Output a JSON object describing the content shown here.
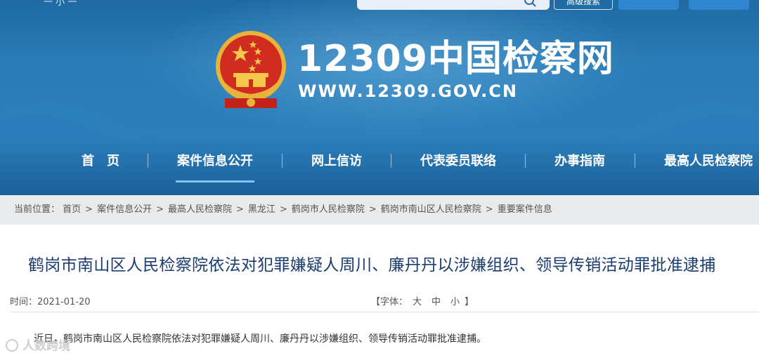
{
  "header": {
    "top_left_text": "一 小 一",
    "advanced_search_label": "高级搜索",
    "site_title": "12309中国检察网",
    "site_url": "WWW.12309.GOV.CN"
  },
  "nav": {
    "items": [
      {
        "label": "首　页"
      },
      {
        "label": "案件信息公开"
      },
      {
        "label": "网上信访"
      },
      {
        "label": "代表委员联络"
      },
      {
        "label": "办事指南"
      },
      {
        "label": "最高人民检察院"
      }
    ],
    "active_index": 1
  },
  "breadcrumb": {
    "prefix": "当前位置：",
    "items": [
      "首页",
      "案件信息公开",
      "最高人民检察院",
      "黑龙江",
      "鹤岗市人民检察院",
      "鹤岗市南山区人民检察院",
      "重要案件信息"
    ],
    "separator": ">"
  },
  "article": {
    "title": "鹤岗市南山区人民检察院依法对犯罪嫌疑人周川、廉丹丹以涉嫌组织、领导传销活动罪批准逮捕",
    "time_label": "时间：",
    "time_value": "2021-01-20",
    "font_size_prefix": "【字体：",
    "font_size_options": [
      "大",
      "中",
      "小"
    ],
    "font_size_suffix": "】",
    "body": "近日，鹤岗市南山区人民检察院依法对犯罪嫌疑人周川、廉丹丹以涉嫌组织、领导传销活动罪批准逮捕。"
  },
  "watermark": "人数跨境",
  "colors": {
    "banner": "#2a7bb6",
    "nav_active_underline": "#7ec6f2",
    "title_text": "#1a3c6e",
    "breadcrumb_bg": "#e9eaec"
  }
}
